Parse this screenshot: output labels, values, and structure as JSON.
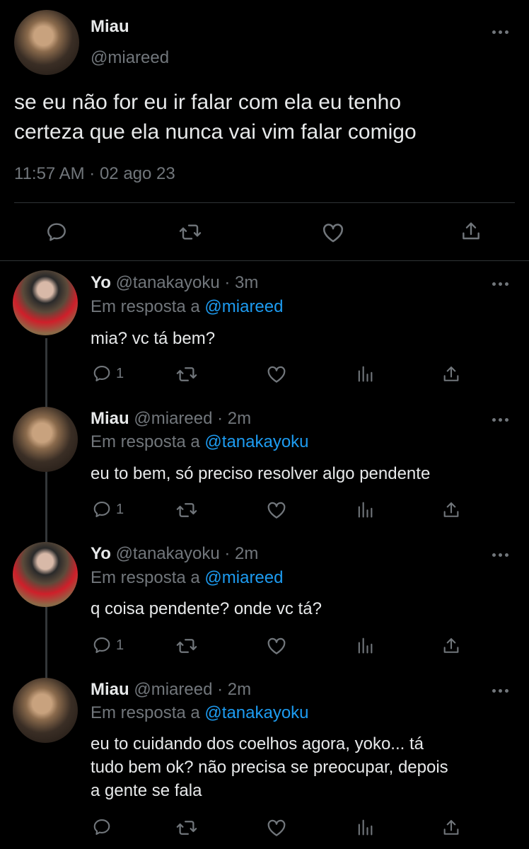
{
  "main_tweet": {
    "name": "Miau",
    "handle": "@miareed",
    "text_line1": "se eu não for eu ir falar com ela eu tenho",
    "text_line2": "certeza que ela nunca vai vim falar comigo",
    "timestamp": "11:57 AM · 02 ago 23"
  },
  "replies": [
    {
      "name": "Yo",
      "handle": "@tanakayoku",
      "time": "· 3m",
      "reply_prefix": "Em resposta a",
      "reply_to": "@miareed",
      "text": "mia? vc tá bem?",
      "reply_count": "1"
    },
    {
      "name": "Miau",
      "handle": "@miareed",
      "time": "· 2m",
      "reply_prefix": "Em resposta a",
      "reply_to": "@tanakayoku",
      "text": "eu to bem, só preciso resolver algo pendente",
      "reply_count": "1"
    },
    {
      "name": "Yo",
      "handle": "@tanakayoku",
      "time": "· 2m",
      "reply_prefix": "Em resposta a",
      "reply_to": "@miareed",
      "text": "q coisa pendente? onde vc tá?",
      "reply_count": "1"
    },
    {
      "name": "Miau",
      "handle": "@miareed",
      "time": "· 2m",
      "reply_prefix": "Em resposta a",
      "reply_to": "@tanakayoku",
      "text_line1": "eu to cuidando dos coelhos agora, yoko... tá",
      "text_line2": "tudo bem ok? não precisa se preocupar, depois",
      "text_line3": "a gente se fala",
      "reply_count": ""
    }
  ],
  "icons": [
    "reply-icon",
    "retweet-icon",
    "like-icon",
    "share-icon",
    "analytics-icon",
    "more-icon"
  ],
  "colors": {
    "background": "#000000",
    "text": "#e7e9ea",
    "secondary": "#71767b",
    "link": "#1d9bf0",
    "divider": "#2f3336"
  }
}
